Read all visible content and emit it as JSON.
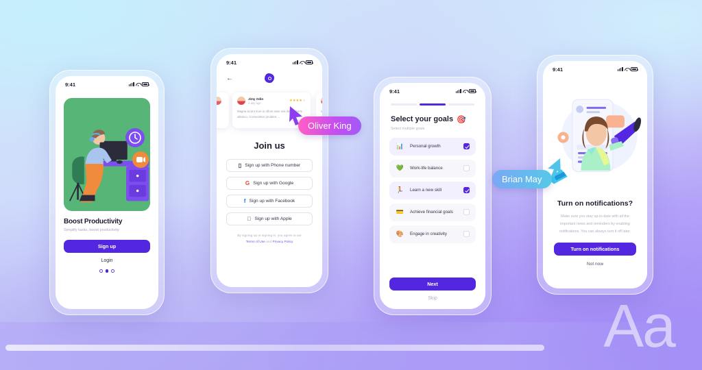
{
  "background": {
    "aa_mark": "Aa",
    "colors": {
      "cyan": "#cfe9fb",
      "violet": "#a896f6",
      "accent": "#5326e0"
    }
  },
  "phones": {
    "onboarding": {
      "status": {
        "time": "9:41",
        "signal_icon": "signal-icon",
        "wifi_icon": "wifi-icon",
        "battery_icon": "battery-icon"
      },
      "illustration": "person-at-desk-illustration",
      "title": "Boost Productivity",
      "subtitle": "Simplify tasks, boost productivity",
      "primary_button": "Sign up",
      "secondary_link": "Login",
      "pager": {
        "count": 3,
        "active_index": 1
      }
    },
    "signup": {
      "status": {
        "time": "9:41"
      },
      "back_icon": "back-arrow-icon",
      "logo_icon": "app-logo-icon",
      "review": {
        "name": "Jimy Odin",
        "time": "A day ago",
        "rating": 4,
        "max_rating": 5,
        "text": "Magna at sint irure in cillum esse nisi dolor laboris ullamco. Consectetur proident ..."
      },
      "heading": "Join us",
      "options": [
        {
          "icon": "phone-icon",
          "glyph": "▯",
          "label": "Sign up with Phone number"
        },
        {
          "icon": "google-icon",
          "glyph": "G",
          "label": "Sign up with Google",
          "color": "#ea4335"
        },
        {
          "icon": "facebook-icon",
          "glyph": "f",
          "label": "Sign up with Facebook",
          "color": "#1877f2"
        },
        {
          "icon": "apple-icon",
          "glyph": "",
          "label": "Sign up with Apple",
          "color": "#1c1c2e"
        }
      ],
      "terms_prefix": "By signing up or signing in, you agree to our",
      "terms_link": "Terms of Use",
      "terms_and": "and",
      "privacy_link": "Privacy Policy"
    },
    "goals": {
      "status": {
        "time": "9:41"
      },
      "progress": {
        "steps": 3,
        "active_index": 1
      },
      "title": "Select your goals",
      "title_emoji": "🎯",
      "subtitle": "Select multiple goals",
      "items": [
        {
          "icon": "bar-chart-growth-icon",
          "glyph": "📊",
          "label": "Personal growth",
          "checked": true
        },
        {
          "icon": "heart-icon",
          "glyph": "💚",
          "label": "Work-life balance",
          "checked": false
        },
        {
          "icon": "running-person-icon",
          "glyph": "🏃",
          "label": "Learn a new skill",
          "checked": true
        },
        {
          "icon": "credit-card-icon",
          "glyph": "💳",
          "label": "Achieve financial goals",
          "checked": false
        },
        {
          "icon": "art-palette-icon",
          "glyph": "🎨",
          "label": "Engage in creativity",
          "checked": false
        }
      ],
      "primary_button": "Next",
      "secondary_link": "Skip"
    },
    "notifications": {
      "status": {
        "time": "9:41"
      },
      "illustration": "woman-with-megaphone-illustration",
      "title": "Turn on notifications?",
      "text": "Make sure you stay up-to-date with all the important news and reminders by enabling notifications. You can always turn it off later.",
      "primary_button": "Turn on notifications",
      "secondary_link": "Not now"
    }
  },
  "cursors": [
    {
      "name": "Oliver King",
      "color_start": "#ff5ec4",
      "color_end": "#a25bf5"
    },
    {
      "name": "Brian May",
      "color_start": "#7ba8f5",
      "color_end": "#55c8e8"
    }
  ]
}
